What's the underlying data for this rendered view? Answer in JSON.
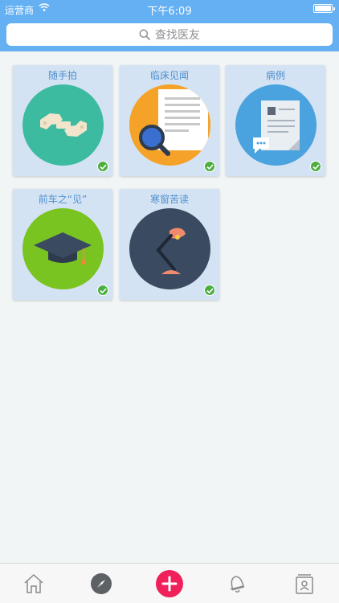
{
  "status_bar": {
    "carrier": "运营商",
    "time": "下午6:09",
    "battery_level": 0.9
  },
  "search": {
    "placeholder": "查找医友"
  },
  "cards": [
    {
      "title": "随手拍",
      "color": "#3dbba0",
      "icon": "camera-hands-icon"
    },
    {
      "title": "临床见闻",
      "color": "#f4a228",
      "icon": "document-magnifier-icon"
    },
    {
      "title": "病例",
      "color": "#4aa3de",
      "icon": "case-document-icon"
    },
    {
      "title": "前车之“见”",
      "color": "#7ac421",
      "icon": "graduation-cap-icon"
    },
    {
      "title": "寒窗苦读",
      "color": "#3a4a60",
      "icon": "desk-lamp-icon"
    }
  ],
  "tabbar": {
    "tabs": [
      {
        "name": "home",
        "icon": "home-icon"
      },
      {
        "name": "discover",
        "icon": "compass-icon"
      },
      {
        "name": "add",
        "icon": "plus-icon",
        "color": "#f0205b"
      },
      {
        "name": "notifications",
        "icon": "bell-icon"
      },
      {
        "name": "contacts",
        "icon": "contacts-icon"
      }
    ]
  }
}
